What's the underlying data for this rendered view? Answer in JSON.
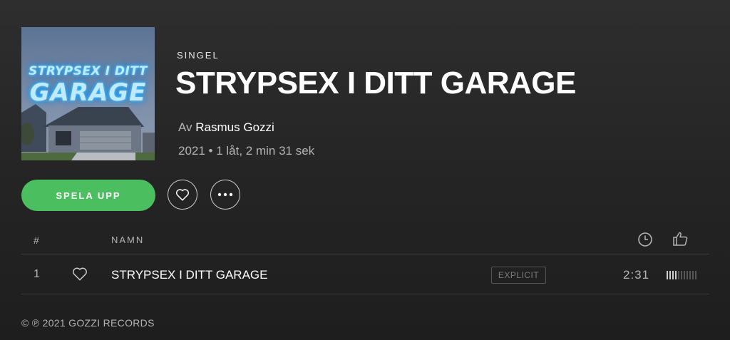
{
  "album": {
    "cover_line1": "STRYPSEX I DITT",
    "cover_line2": "GARAGE",
    "type_label": "SINGEL",
    "title": "STRYPSEX I DITT GARAGE",
    "by_prefix": "Av",
    "artist": "Rasmus Gozzi",
    "meta": "2021 • 1 låt, 2 min 31 sek"
  },
  "actions": {
    "play_label": "SPELA UPP",
    "heart_icon": "heart-outline-icon",
    "more_icon": "ellipsis-icon"
  },
  "tracklist": {
    "header_number": "#",
    "header_name": "NAMN",
    "header_duration_icon": "clock-icon",
    "header_popularity_icon": "thumbs-up-icon",
    "rows": [
      {
        "number": "1",
        "title": "STRYPSEX I DITT GARAGE",
        "explicit": "EXPLICIT",
        "duration": "2:31",
        "popularity": 0.4
      }
    ]
  },
  "copyright": "© ℗ 2021 GOZZI RECORDS",
  "colors": {
    "background": "#272727",
    "play_button": "#4bbf5f",
    "muted_text": "#b3b3b3"
  }
}
